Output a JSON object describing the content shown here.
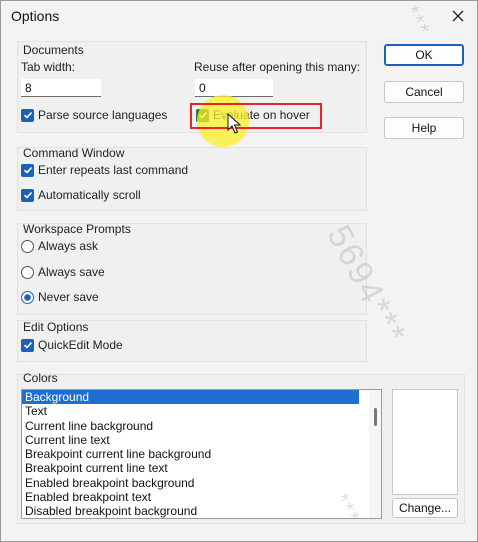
{
  "window": {
    "title": "Options"
  },
  "documents": {
    "group_label": "Documents",
    "tab_width_label": "Tab width:",
    "tab_width_value": "8",
    "reuse_label": "Reuse after opening this many:",
    "reuse_value": "0",
    "parse_label": "Parse source languages",
    "parse_checked": true,
    "hover_label": "Evaluate on hover",
    "hover_checked": true
  },
  "command_window": {
    "group_label": "Command Window",
    "enter_repeats_label": "Enter repeats last command",
    "enter_repeats_checked": true,
    "auto_scroll_label": "Automatically scroll",
    "auto_scroll_checked": true
  },
  "workspace_prompts": {
    "group_label": "Workspace Prompts",
    "options": [
      {
        "label": "Always ask",
        "selected": false
      },
      {
        "label": "Always save",
        "selected": false
      },
      {
        "label": "Never save",
        "selected": true
      }
    ]
  },
  "edit_options": {
    "group_label": "Edit Options",
    "quickedit_label": "QuickEdit Mode",
    "quickedit_checked": true
  },
  "colors": {
    "group_label": "Colors",
    "items": [
      "Background",
      "Text",
      "Current line background",
      "Current line text",
      "Breakpoint current line background",
      "Breakpoint current line text",
      "Enabled breakpoint background",
      "Enabled breakpoint text",
      "Disabled breakpoint background"
    ],
    "selected_index": 0,
    "change_label": "Change..."
  },
  "buttons": {
    "ok": "OK",
    "cancel": "Cancel",
    "help": "Help"
  },
  "watermark": {
    "text1": "5694***",
    "text2": "***",
    "text3": "***"
  },
  "style": {
    "accent": "#1e62b8",
    "highlight_box": "#e4262b",
    "spotlight": "#faf028"
  }
}
